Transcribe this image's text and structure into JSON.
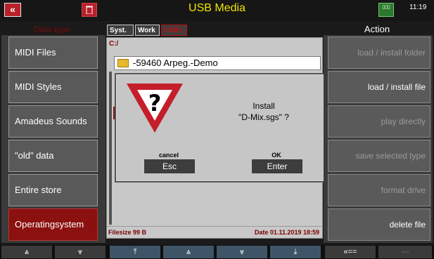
{
  "title_bar": {
    "back_glyph": "«",
    "title": "USB Media",
    "icon_text": "▯▯▯",
    "clock": "11:19"
  },
  "left": {
    "header": "Data type",
    "items": [
      {
        "label": "MIDI Files"
      },
      {
        "label": "MIDI Styles"
      },
      {
        "label": "Amadeus Sounds"
      },
      {
        "label": "\"old\" data"
      },
      {
        "label": "Entire store"
      },
      {
        "label": "Operatingsystem"
      }
    ]
  },
  "middle": {
    "tabs": [
      "Syst.",
      "Work",
      "USB1"
    ],
    "path": "C:/",
    "file": "-59460 Arpeg.-Demo",
    "filesize": "Filesize 99 B",
    "date": "Date 01.11.2019   18:59"
  },
  "dialog": {
    "line1": "Install",
    "line2": "\"D-Mix.sgs\" ?",
    "cancel_label": "cancel",
    "cancel_button": "Esc",
    "ok_label": "OK",
    "ok_button": "Enter"
  },
  "right": {
    "header": "Action",
    "items": [
      {
        "label": "load  /  install folder"
      },
      {
        "label": "load  /  install file"
      },
      {
        "label": "play directly"
      },
      {
        "label": "save selected type"
      },
      {
        "label": "format drive"
      },
      {
        "label": "delete file"
      }
    ]
  },
  "bottom": {
    "buttons": [
      "⩓",
      "⩔",
      "⤒",
      "⩓",
      "⩔",
      "⤓",
      "«==",
      "---"
    ]
  }
}
